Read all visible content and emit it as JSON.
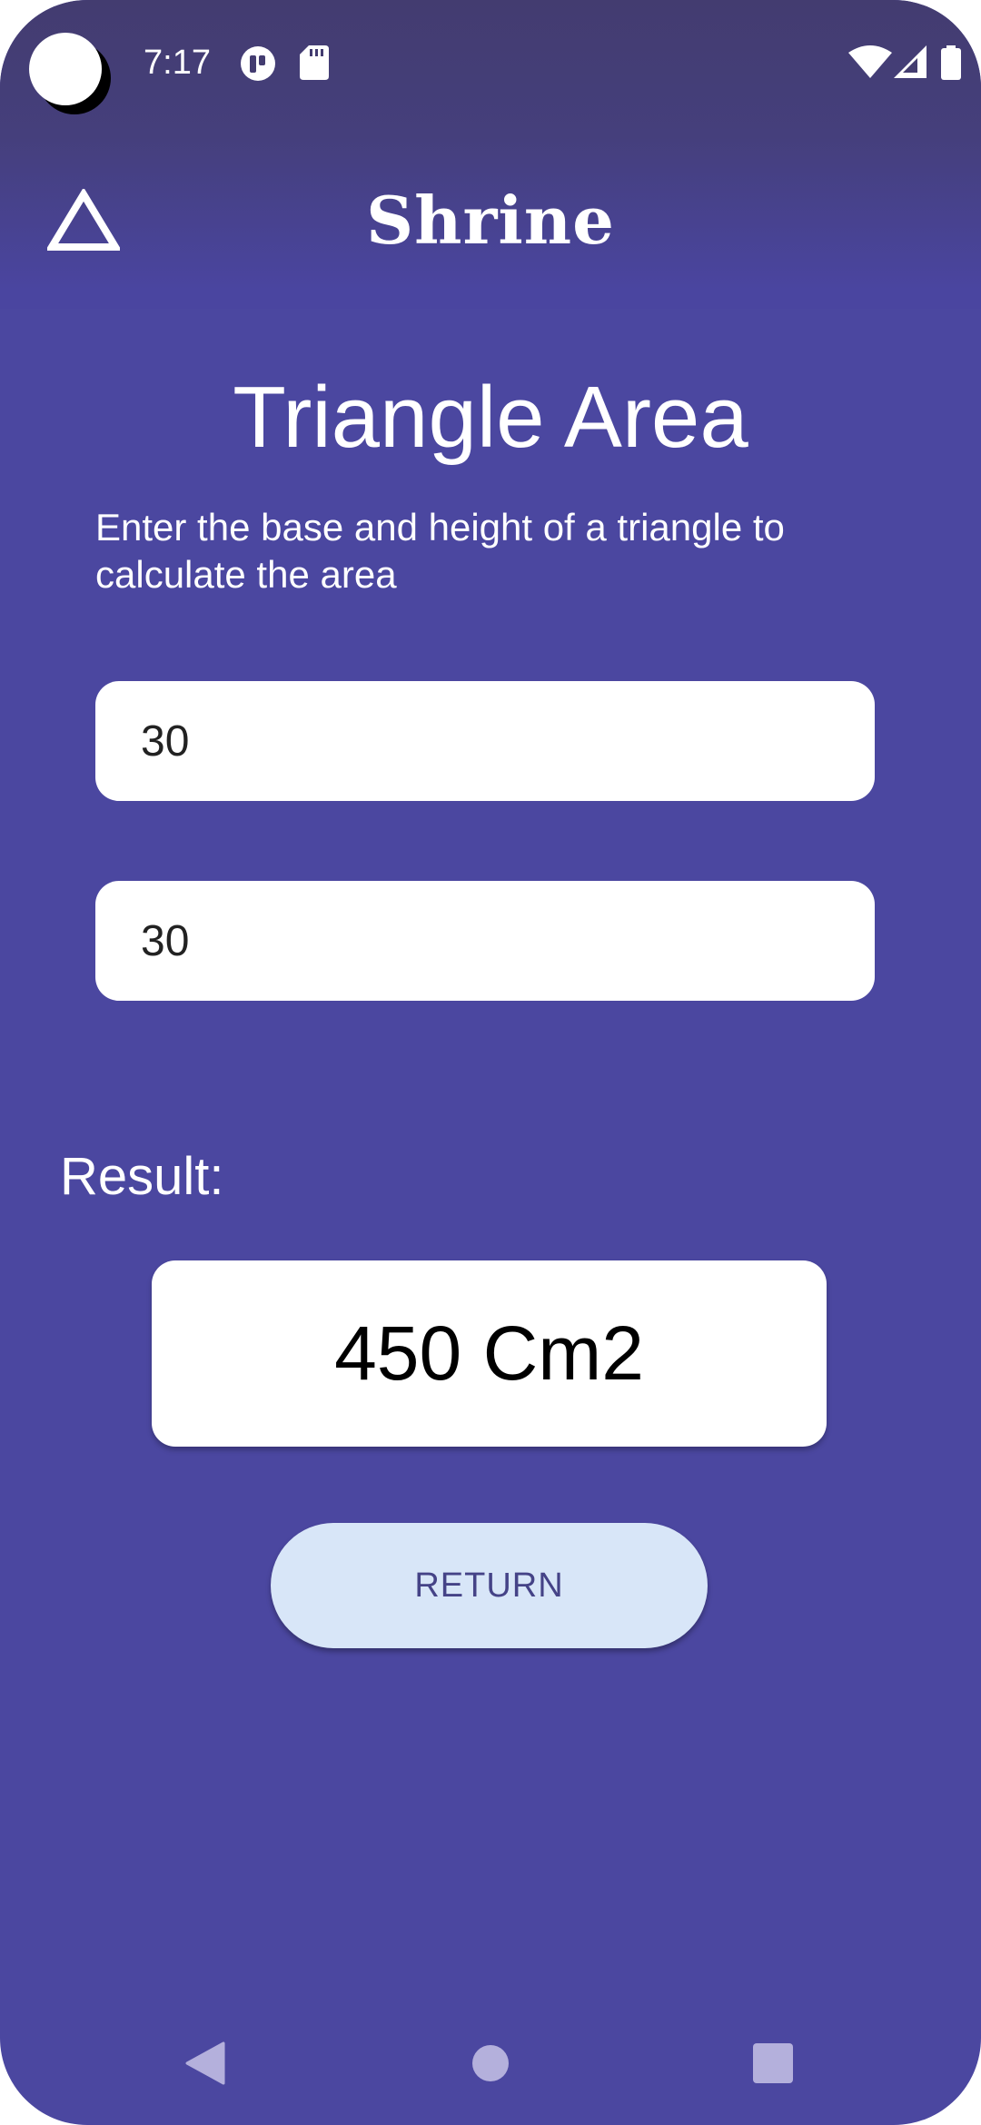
{
  "status_bar": {
    "time": "7:17",
    "icons": [
      "camera-icon",
      "notification-app-icon",
      "sd-card-icon",
      "wifi-icon",
      "cell-signal-icon",
      "battery-icon"
    ]
  },
  "app_bar": {
    "title": "Shrine",
    "menu_icon": "triangle-outline-icon"
  },
  "page": {
    "title": "Triangle Area",
    "instructions": "Enter the base and height of a triangle to calculate the area",
    "base_value": "30",
    "height_value": "30",
    "result_label": "Result:",
    "result_value": "450 Cm2",
    "return_label": "RETURN"
  },
  "nav_bar": {
    "icons": [
      "back-icon",
      "home-icon",
      "recents-icon"
    ]
  },
  "colors": {
    "background": "#4b47a0",
    "status_bar_top": "#433c70",
    "button_fill": "#d8e6f8",
    "button_text": "#454387"
  }
}
